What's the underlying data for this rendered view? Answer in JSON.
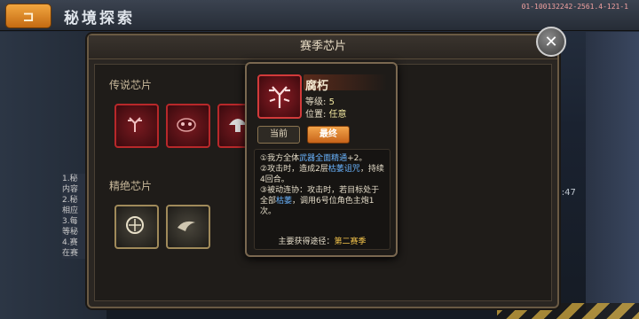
{
  "topbar": {
    "back_label": "⊐",
    "title": "秘境探索",
    "id_text": "01-100132242-2561.4-121-1"
  },
  "modal": {
    "title": "赛季芯片",
    "close_label": "✕"
  },
  "sections": {
    "legend": "传说芯片",
    "elite": "精绝芯片"
  },
  "left_note": "1.秘\n内容\n2.秘\n相应\n3.每\n等秘\n4.赛\n在赛",
  "time_text": "51:47",
  "tooltip": {
    "name": "腐朽",
    "level_label": "等级:",
    "level_value": "5",
    "position_label": "位置:",
    "position_value": "任意",
    "tab_current": "当前",
    "tab_final": "最终",
    "desc1_a": "①我方全体",
    "desc1_b": "武器全面精通",
    "desc1_c": "+2。",
    "desc2_a": "②攻击时，造成2层",
    "desc2_b": "枯萎诅咒",
    "desc2_c": "，持续4回合。",
    "desc3_a": "③被动连协：攻击时，若目标处于全部",
    "desc3_b": "枯萎",
    "desc3_c": "，调用6号位角色主炮1次。",
    "source_label": "主要获得途径：",
    "source_value": "第二赛季"
  },
  "colors": {
    "accent": "#e8842a",
    "legend_border": "#b8282a",
    "elite_border": "#a08a5a",
    "link": "#6ab4ff",
    "highlight": "#f2c24a"
  },
  "icons": [
    "back-arrow-icon",
    "close-icon",
    "antler-chip-icon",
    "mask-chip-icon",
    "mushroom-chip-icon",
    "crosshair-chip-icon",
    "wings-chip-icon"
  ]
}
